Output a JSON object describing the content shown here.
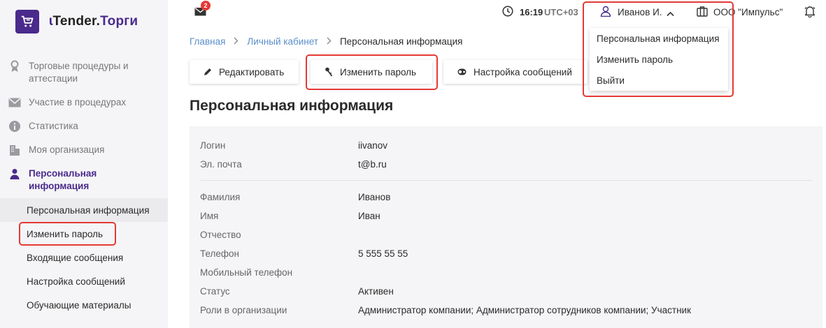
{
  "app": {
    "logo_brand": "Tender.",
    "logo_accent": "Торги"
  },
  "sidebar": {
    "items": [
      {
        "label": "Торговые процедуры и аттестации",
        "icon": "ribbon-icon"
      },
      {
        "label": "Участие в процедурах",
        "icon": "envelope-icon"
      },
      {
        "label": "Статистика",
        "icon": "info-icon"
      },
      {
        "label": "Моя организация",
        "icon": "building-icon"
      },
      {
        "label": "Персональная информация",
        "icon": "person-icon"
      }
    ],
    "subitems": [
      {
        "label": "Персональная информация"
      },
      {
        "label": "Изменить пароль"
      },
      {
        "label": "Входящие сообщения"
      },
      {
        "label": "Настройка сообщений"
      },
      {
        "label": "Обучающие материалы"
      }
    ]
  },
  "topbar": {
    "mail_count": "2",
    "time": "16:19",
    "timezone": "UTC+03",
    "user": "Иванов И.",
    "organization": "ООО \"Импульс\""
  },
  "breadcrumb": {
    "home": "Главная",
    "cabinet": "Личный кабинет",
    "current": "Персональная информация"
  },
  "toolbar": {
    "edit": "Редактировать",
    "change_password": "Изменить пароль",
    "message_settings": "Настройка сообщений"
  },
  "page_title": "Персональная информация",
  "account": [
    {
      "label": "Логин",
      "value": "iivanov"
    },
    {
      "label": "Эл. почта",
      "value": "t@b.ru"
    }
  ],
  "details": [
    {
      "label": "Фамилия",
      "value": "Иванов"
    },
    {
      "label": "Имя",
      "value": "Иван"
    },
    {
      "label": "Отчество",
      "value": ""
    },
    {
      "label": "Телефон",
      "value": "5 555 55 55"
    },
    {
      "label": "Мобильный телефон",
      "value": ""
    },
    {
      "label": "Статус",
      "value": "Активен"
    },
    {
      "label": "Роли в организации",
      "value": "Администратор компании; Администратор сотрудников компании; Участник"
    }
  ],
  "user_menu": {
    "items": [
      {
        "label": "Персональная информация"
      },
      {
        "label": "Изменить пароль"
      },
      {
        "label": "Выйти"
      }
    ]
  },
  "colors": {
    "brand": "#4a2a8c",
    "link": "#5b8ec9",
    "highlight": "#e53935",
    "panel": "#f5f5f7"
  }
}
